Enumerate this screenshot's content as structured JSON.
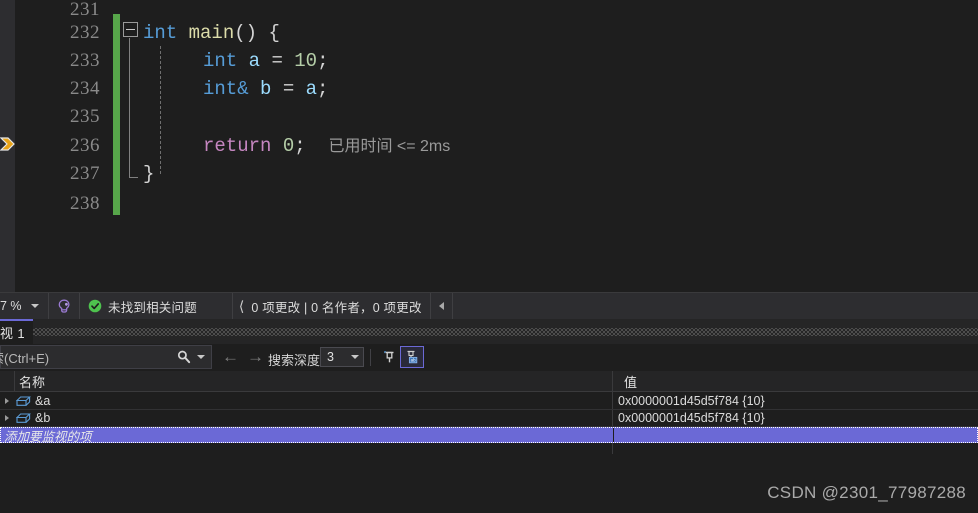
{
  "editor": {
    "line_numbers": [
      "231",
      "232",
      "233",
      "234",
      "235",
      "236",
      "237",
      "238"
    ],
    "nav_arrow_icon": "orange-right-arrow-icon",
    "change_bar_color": "#57a64a",
    "collapse_icon": "collapse-minus-icon",
    "lines": {
      "l232": {
        "kw": "int",
        "fn": "main",
        "parens": "()",
        "brace": "{"
      },
      "l233": {
        "kw": "int",
        "ident": "a",
        "eq": "=",
        "num": "10",
        "semi": ";"
      },
      "l234": {
        "kw": "int&",
        "ident": "b",
        "eq": "=",
        "ident2": "a",
        "semi": ";"
      },
      "l236": {
        "ctl": "return",
        "num": "0",
        "semi": ";",
        "hint": "已用时间 <= 2ms"
      },
      "l237": {
        "brace": "}"
      }
    },
    "colors": {
      "keyword": "#569CD6",
      "function": "#DCDCAA",
      "identifier": "#9CDCFE",
      "number": "#B5CEA8",
      "control": "#C586C0",
      "plain": "#D4D4D4",
      "hint": "#9A9A9A"
    }
  },
  "statusbar": {
    "zoom_value": "7 %",
    "zoom_dropdown_icon": "chevron-down-icon",
    "copilot_icon": "copilot-icon",
    "ok_icon": "check-circle-icon",
    "status_text": "未找到相关问题",
    "git_chevron_icon": "chevron-left-icon",
    "git_text": "0 项更改 | 0 名作者，0 项更改",
    "git_more_icon": "triangle-left-icon"
  },
  "watch": {
    "tab_label": "视 1",
    "tab_accent": "#6B69D6",
    "search": {
      "placeholder": "索(Ctrl+E)",
      "search_icon": "search-icon",
      "dropdown_icon": "chevron-down-icon"
    },
    "nav_back_icon": "arrow-left-icon",
    "nav_forward_icon": "arrow-right-icon",
    "depth_label": "搜索深度:",
    "depth_value": "3",
    "depth_dropdown_icon": "chevron-down-icon",
    "pin_icon": "pin-icon",
    "rename_icon": "rename-variable-icon",
    "columns": [
      "名称",
      "值"
    ],
    "rows": [
      {
        "expander_icon": "expander-triangle-icon",
        "type_icon": "object-box-icon",
        "name": "&a",
        "value": "0x0000001d45d5f784 {10}"
      },
      {
        "expander_icon": "expander-triangle-icon",
        "type_icon": "object-box-icon",
        "name": "&b",
        "value": "0x0000001d45d5f784 {10}"
      }
    ],
    "add_row_placeholder": "添加要监视的项",
    "selection_color": "#6B69D6"
  },
  "watermark": "CSDN @2301_77987288"
}
